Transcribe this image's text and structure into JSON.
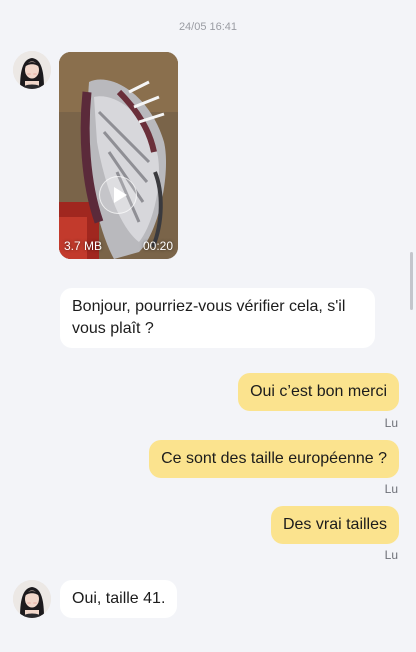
{
  "timestamp": "24/05 16:41",
  "video": {
    "size": "3.7 MB",
    "duration": "00:20"
  },
  "messages": {
    "incoming_1": "Bonjour, pourriez-vous vérifier cela, s'il vous plaît ?",
    "outgoing_1": "Oui c’est bon merci",
    "outgoing_2": "Ce sont des taille européenne ?",
    "outgoing_3": "Des vrai tailles",
    "incoming_2": "Oui, taille 41."
  },
  "read_receipt": "Lu",
  "colors": {
    "background": "#f3f4f8",
    "incoming_bubble": "#ffffff",
    "outgoing_bubble": "#fbe38e"
  },
  "icons": {
    "play": "play-icon",
    "avatar": "contact-avatar"
  }
}
